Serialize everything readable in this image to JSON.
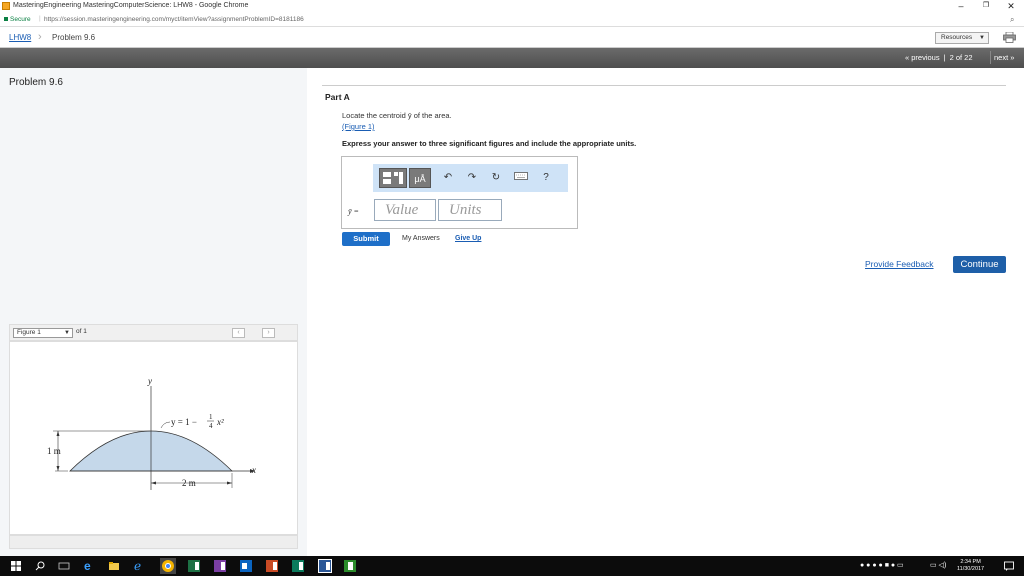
{
  "browser": {
    "title": "MasteringEngineering MasteringComputerScience: LHW8 - Google Chrome",
    "secure_label": "Secure",
    "url": "https://session.masteringengineering.com/myct/itemView?assignmentProblemID=8181186",
    "minimize": "–",
    "restore": "❐",
    "close": "✕"
  },
  "breadcrumb": {
    "home": "LHW8",
    "current": "Problem 9.6",
    "resources_label": "Resources"
  },
  "nav": {
    "previous": "« previous",
    "counter": "2 of 22",
    "next": "next »"
  },
  "problem": {
    "title": "Problem 9.6",
    "part": "Part A",
    "question": "Locate the centroid ȳ of the area.",
    "figure_link": "(Figure 1)",
    "instruction": "Express your answer to three significant figures and include the appropriate units.",
    "answer_label": "ȳ =",
    "value_placeholder": "Value",
    "units_placeholder": "Units",
    "toolbar": {
      "mu_label": "μÅ",
      "help": "?"
    },
    "submit": "Submit",
    "my_answers": "My Answers",
    "give_up": "Give Up",
    "feedback": "Provide Feedback",
    "continue": "Continue"
  },
  "figure": {
    "selector": "Figure 1",
    "of": "of 1",
    "prev": "‹",
    "next": "›",
    "labels": {
      "y_axis": "y",
      "x_axis": "x",
      "equation": "y = 1 − ",
      "eq_num": "1",
      "eq_den": "4",
      "eq_var": "x²",
      "height": "1 m",
      "width": "2 m"
    }
  },
  "taskbar": {
    "time": "2:34 PM",
    "date": "11/30/2017"
  },
  "colors": {
    "link": "#1a5db3",
    "button": "#1e6fc8",
    "nav_bar": "#5a5a5a",
    "toolbar_bg": "#cfe3f7",
    "area_fill": "#c5d8ea"
  }
}
